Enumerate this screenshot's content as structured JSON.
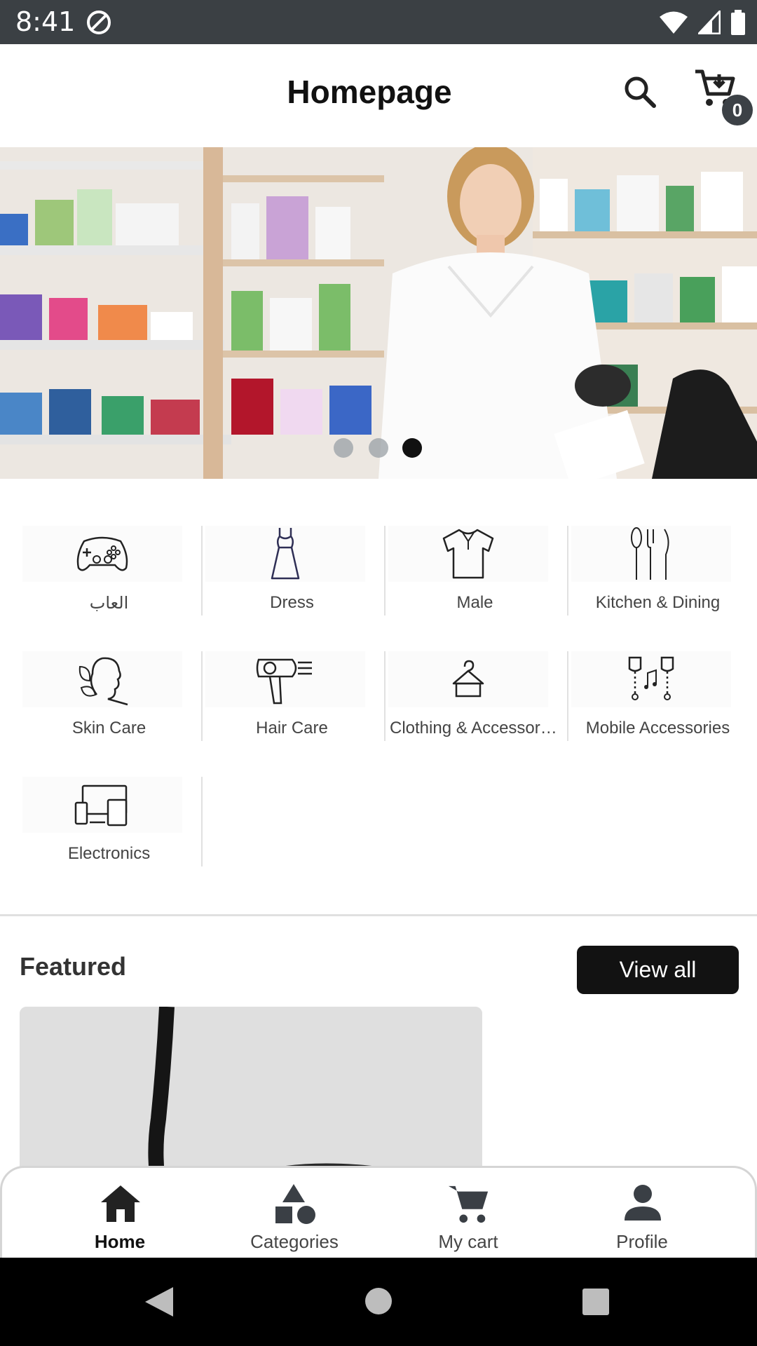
{
  "status_bar": {
    "time": "8:41"
  },
  "app_bar": {
    "title": "Homepage",
    "cart_count": "0"
  },
  "banner": {
    "slide_count": 3,
    "active_slide": 3
  },
  "categories": [
    {
      "label": "العاب",
      "icon": "gamepad-icon"
    },
    {
      "label": "Dress",
      "icon": "dress-icon"
    },
    {
      "label": "Male",
      "icon": "shirt-icon"
    },
    {
      "label": "Kitchen & Dining",
      "icon": "kitchen-utensils-icon"
    },
    {
      "label": "Skin Care",
      "icon": "skin-care-icon"
    },
    {
      "label": "Hair Care",
      "icon": "hair-dryer-icon"
    },
    {
      "label": "Clothing & Accessories",
      "icon": "hanger-icon"
    },
    {
      "label": "Mobile Accessories",
      "icon": "earphones-icon"
    },
    {
      "label": "Electronics",
      "icon": "devices-icon"
    }
  ],
  "featured": {
    "title": "Featured",
    "view_all_label": "View all"
  },
  "bottom_nav": [
    {
      "label": "Home",
      "icon": "home-icon",
      "active": true
    },
    {
      "label": "Categories",
      "icon": "categories-icon",
      "active": false
    },
    {
      "label": "My cart",
      "icon": "cart-icon",
      "active": false
    },
    {
      "label": "Profile",
      "icon": "person-icon",
      "active": false
    }
  ]
}
